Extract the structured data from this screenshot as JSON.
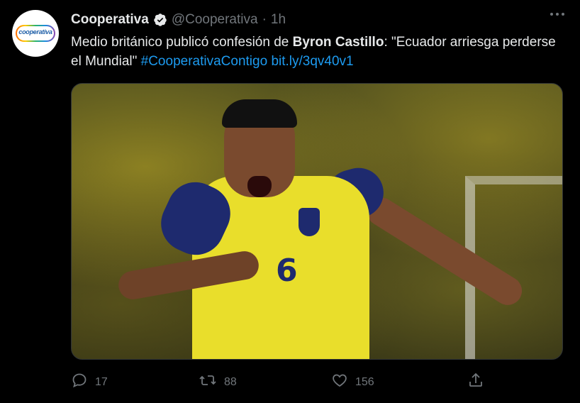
{
  "tweet": {
    "author_name": "Cooperativa",
    "handle": "@Cooperativa",
    "separator": "·",
    "time": "1h",
    "avatar_logo_text": "cooperativa",
    "text_part1": "Medio británico publicó confesión de ",
    "text_bold": "Byron Castillo",
    "text_part2": ": \"Ecuador arriesga perderse el Mundial\" ",
    "hashtag": "#CooperativaContigo",
    "link": "bit.ly/3qv40v1",
    "jersey_number": "6"
  },
  "actions": {
    "replies": "17",
    "retweets": "88",
    "likes": "156"
  },
  "colors": {
    "background": "#000000",
    "text": "#e7e9ea",
    "muted": "#71767b",
    "link": "#1d9bf0",
    "verified": "#e7e9ea"
  },
  "icons": [
    "verified-badge-icon",
    "more-icon",
    "reply-icon",
    "retweet-icon",
    "like-icon",
    "share-icon"
  ]
}
